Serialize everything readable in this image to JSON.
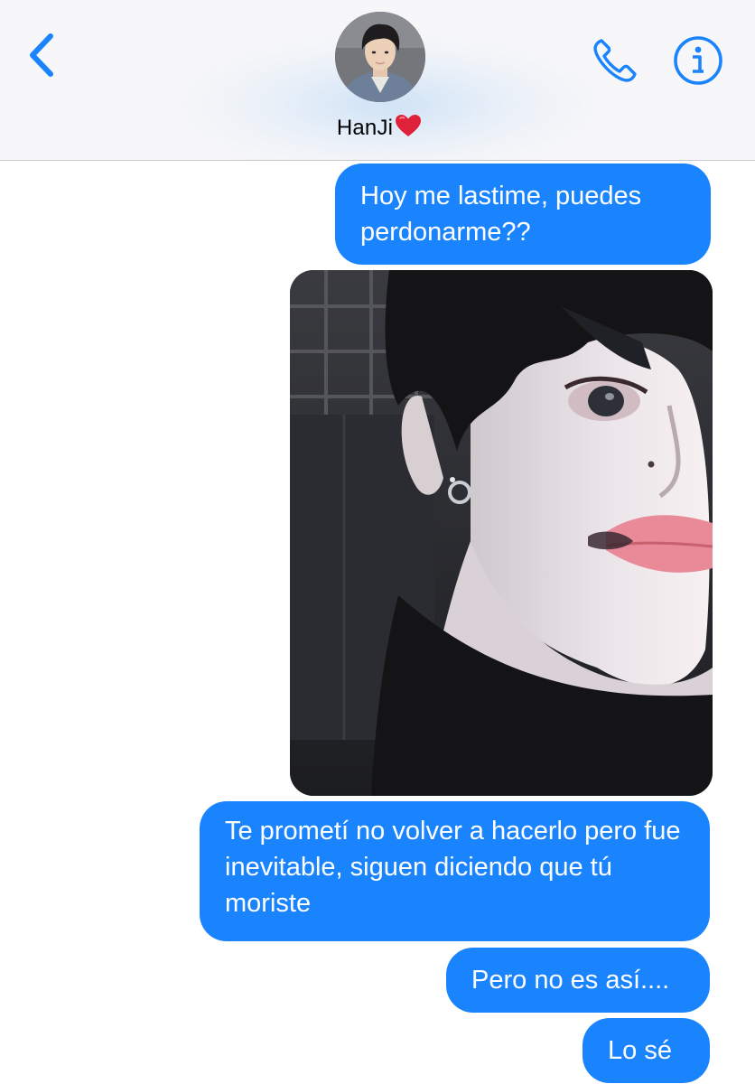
{
  "header": {
    "contact_name": "HanJi",
    "contact_emoji": "heart-emoji-red",
    "back_icon": "chevron-left-icon",
    "call_icon": "phone-icon",
    "info_icon": "info-icon",
    "accent_color": "#1a84fe"
  },
  "messages": [
    {
      "type": "text",
      "sender": "me",
      "text": "Hoy me lastime, puedes perdonarme??"
    },
    {
      "type": "image",
      "sender": "me",
      "description_icon": "photo-attachment"
    },
    {
      "type": "text",
      "sender": "me",
      "text": "Te prometí no volver a hacerlo pero fue inevitable, siguen diciendo que tú moriste"
    },
    {
      "type": "text",
      "sender": "me",
      "text": "Pero no es así...."
    },
    {
      "type": "text",
      "sender": "me",
      "text": "Lo sé"
    }
  ],
  "colors": {
    "bubble": "#1a84fe",
    "bubble_text": "#ffffff",
    "header_bg": "#f7f7f9"
  }
}
